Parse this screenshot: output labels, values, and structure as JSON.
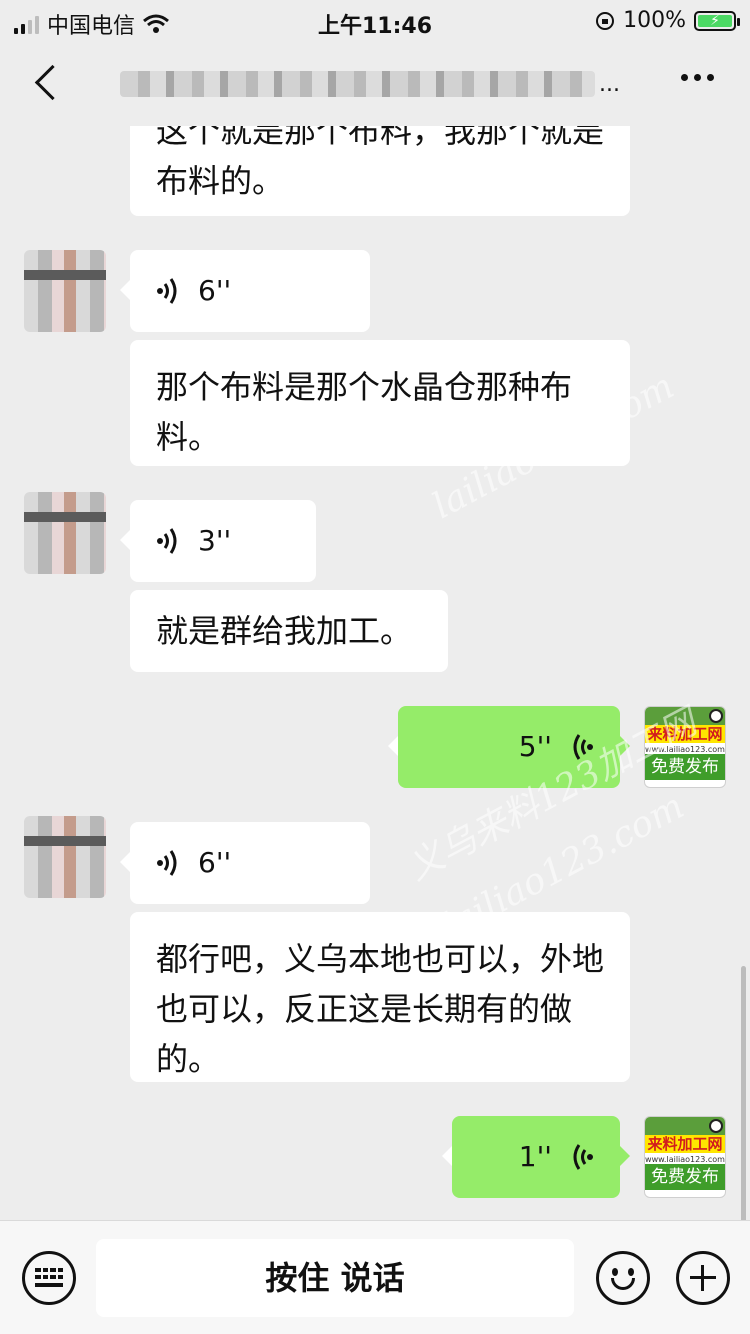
{
  "status_bar": {
    "carrier": "中国电信",
    "time": "上午11:46",
    "battery": "100%"
  },
  "nav": {
    "title_more": "..."
  },
  "messages": [
    {
      "from": "them",
      "type": "text",
      "text": "这个就是那个布料，我那个就是布料的。"
    },
    {
      "from": "them",
      "type": "voice",
      "duration": "6''"
    },
    {
      "from": "them",
      "type": "text",
      "text": "那个布料是那个水晶仓那种布料。"
    },
    {
      "from": "them",
      "type": "voice",
      "duration": "3''"
    },
    {
      "from": "them",
      "type": "text",
      "text": "就是群给我加工。"
    },
    {
      "from": "me",
      "type": "voice",
      "duration": "5''"
    },
    {
      "from": "them",
      "type": "voice",
      "duration": "6''"
    },
    {
      "from": "them",
      "type": "text",
      "text": "都行吧，义乌本地也可以，外地也可以，反正这是长期有的做的。"
    },
    {
      "from": "me",
      "type": "voice",
      "duration": "1''"
    }
  ],
  "my_avatar": {
    "brand": "来料加工网",
    "site": "www.lailiao123.com",
    "tagline": "免费发布"
  },
  "watermark": {
    "line1": "义乌来料123加工网",
    "line2": "lailiao123.com"
  },
  "input_bar": {
    "talk_label": "按住 说话"
  },
  "icons": [
    "back-icon",
    "more-icon",
    "voice-wave-icon",
    "keyboard-icon",
    "emoji-icon",
    "plus-icon",
    "wifi-icon",
    "battery-icon"
  ],
  "colors": {
    "bubble_me": "#95ec69",
    "bubble_them": "#ffffff",
    "background": "#ededed"
  }
}
